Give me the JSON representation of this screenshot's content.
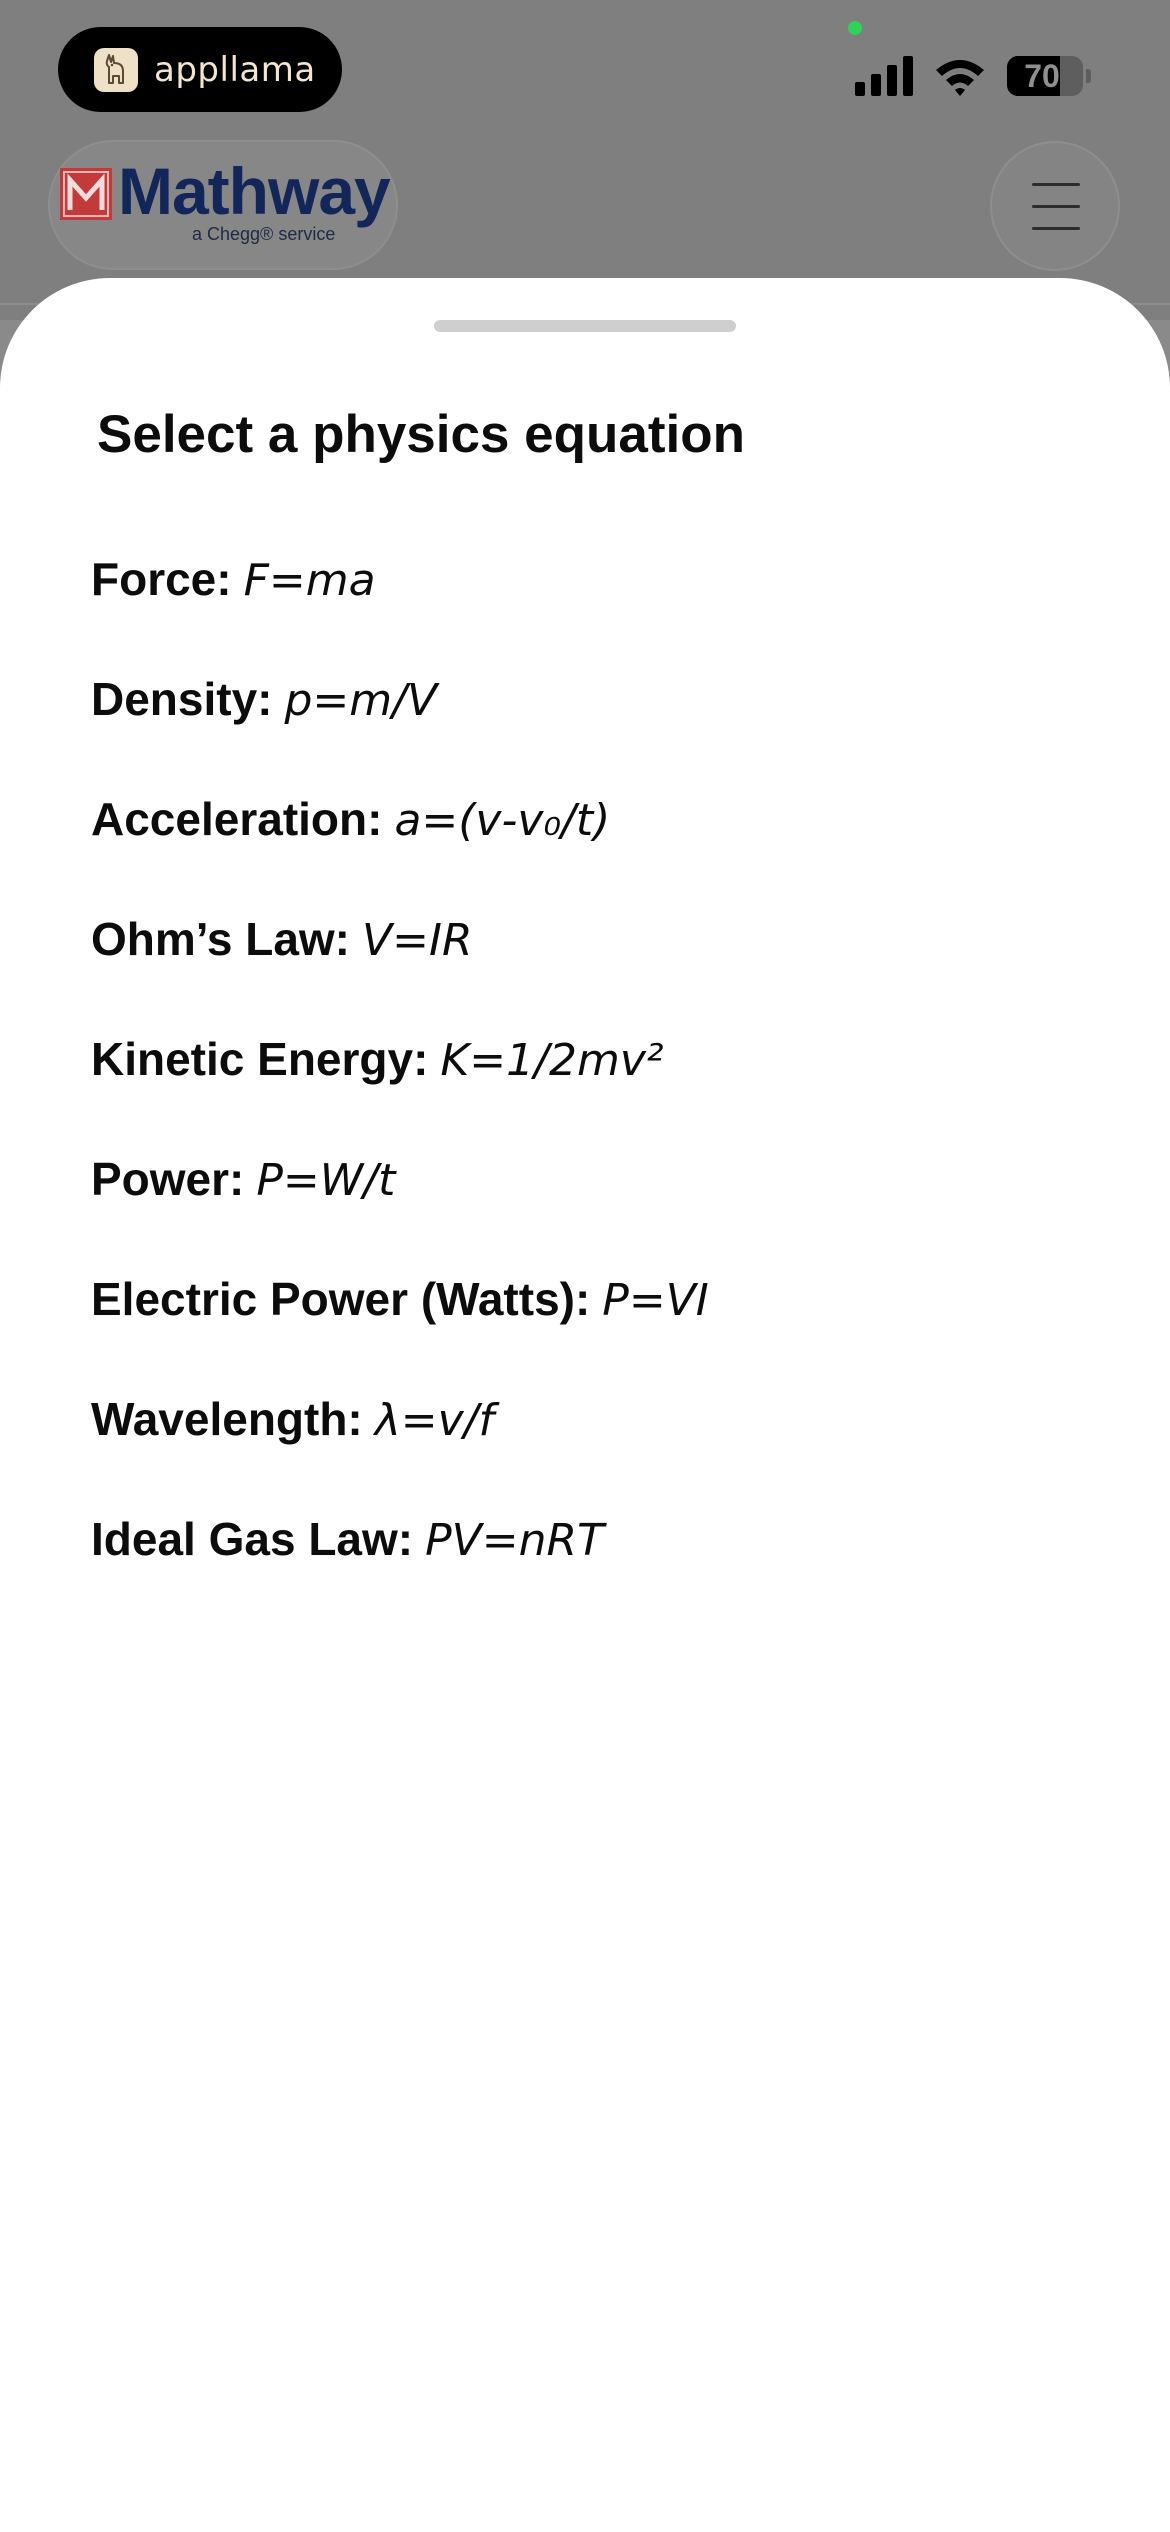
{
  "status_bar": {
    "app_pill_label": "appllama",
    "battery_level": "70",
    "battery_fraction": 0.7
  },
  "header": {
    "logo_word": "Mathway",
    "logo_mark": "M",
    "logo_sub": "a Chegg® service",
    "menu_icon": "hamburger-menu-icon"
  },
  "sheet": {
    "title": "Select a physics equation",
    "equations": [
      {
        "name": "Force:",
        "formula": "F=ma"
      },
      {
        "name": "Density:",
        "formula": "p=m/V"
      },
      {
        "name": "Acceleration:",
        "formula": "a=(v-v₀/t)"
      },
      {
        "name": "Ohm’s Law:",
        "formula": "V=IR"
      },
      {
        "name": "Kinetic Energy:",
        "formula": "K=1/2mv²"
      },
      {
        "name": "Power:",
        "formula": "P=W/t"
      },
      {
        "name": "Electric Power (Watts):",
        "formula": "P=VI"
      },
      {
        "name": "Wavelength:",
        "formula": "λ=v/f"
      },
      {
        "name": "Ideal Gas Law:",
        "formula": "PV=nRT"
      }
    ]
  },
  "colors": {
    "overlay": "#7f7f7f",
    "sheet": "#ffffff",
    "text": "#0c0c0c",
    "logo_blue": "#13265a",
    "logo_red": "#c23a3a"
  }
}
